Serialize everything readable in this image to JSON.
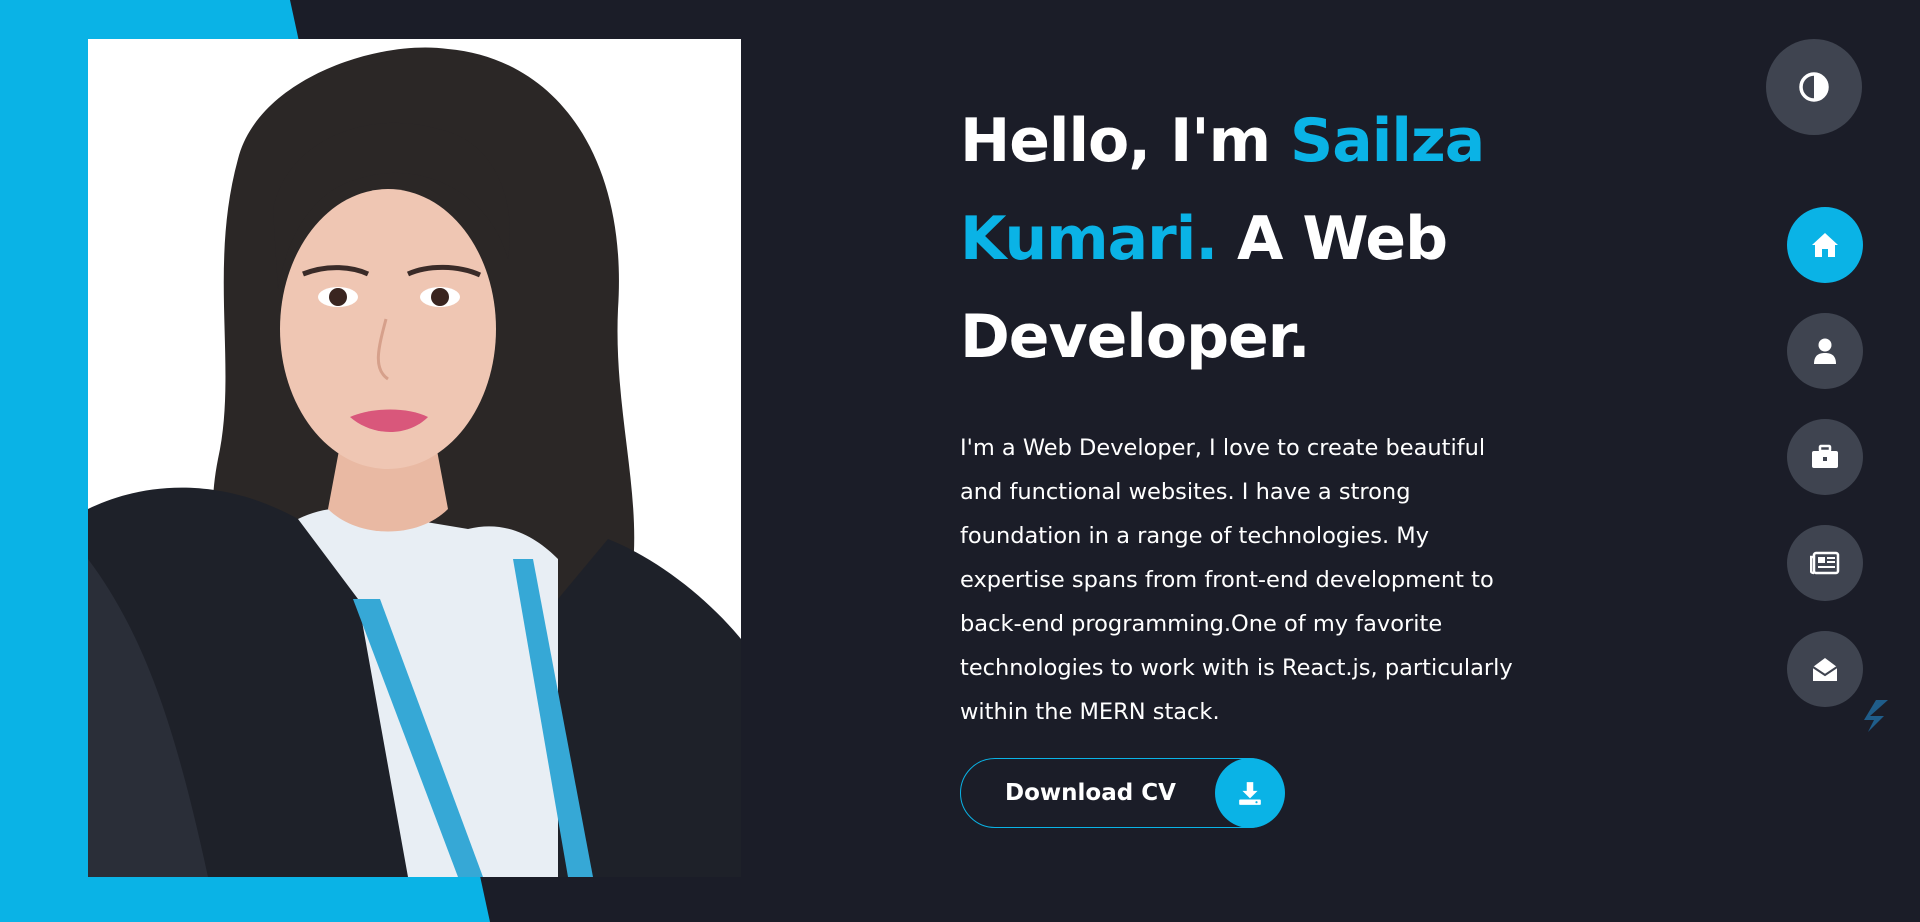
{
  "hero": {
    "greeting": "Hello, I'm ",
    "name": "Sailza Kumari.",
    "role": " A Web Developer.",
    "bio": "I'm a Web Developer, I love to create beautiful and functional websites. I have a strong foundation in a range of technologies. My expertise spans from front-end development to back-end programming.One of my favorite technologies to work with is React.js, particularly within the MERN stack."
  },
  "cv_button": {
    "label": "Download CV",
    "icon": "download-icon"
  },
  "theme_toggle": {
    "icon": "contrast-icon"
  },
  "nav": {
    "items": [
      {
        "name": "home",
        "icon": "home-icon",
        "active": true
      },
      {
        "name": "about",
        "icon": "user-icon",
        "active": false
      },
      {
        "name": "portfolio",
        "icon": "briefcase-icon",
        "active": false
      },
      {
        "name": "blog",
        "icon": "newspaper-icon",
        "active": false
      },
      {
        "name": "contact",
        "icon": "envelope-open-icon",
        "active": false
      }
    ]
  },
  "colors": {
    "accent": "#0ab3e6",
    "background": "#1b1d28",
    "button_bg": "#3f4450"
  }
}
